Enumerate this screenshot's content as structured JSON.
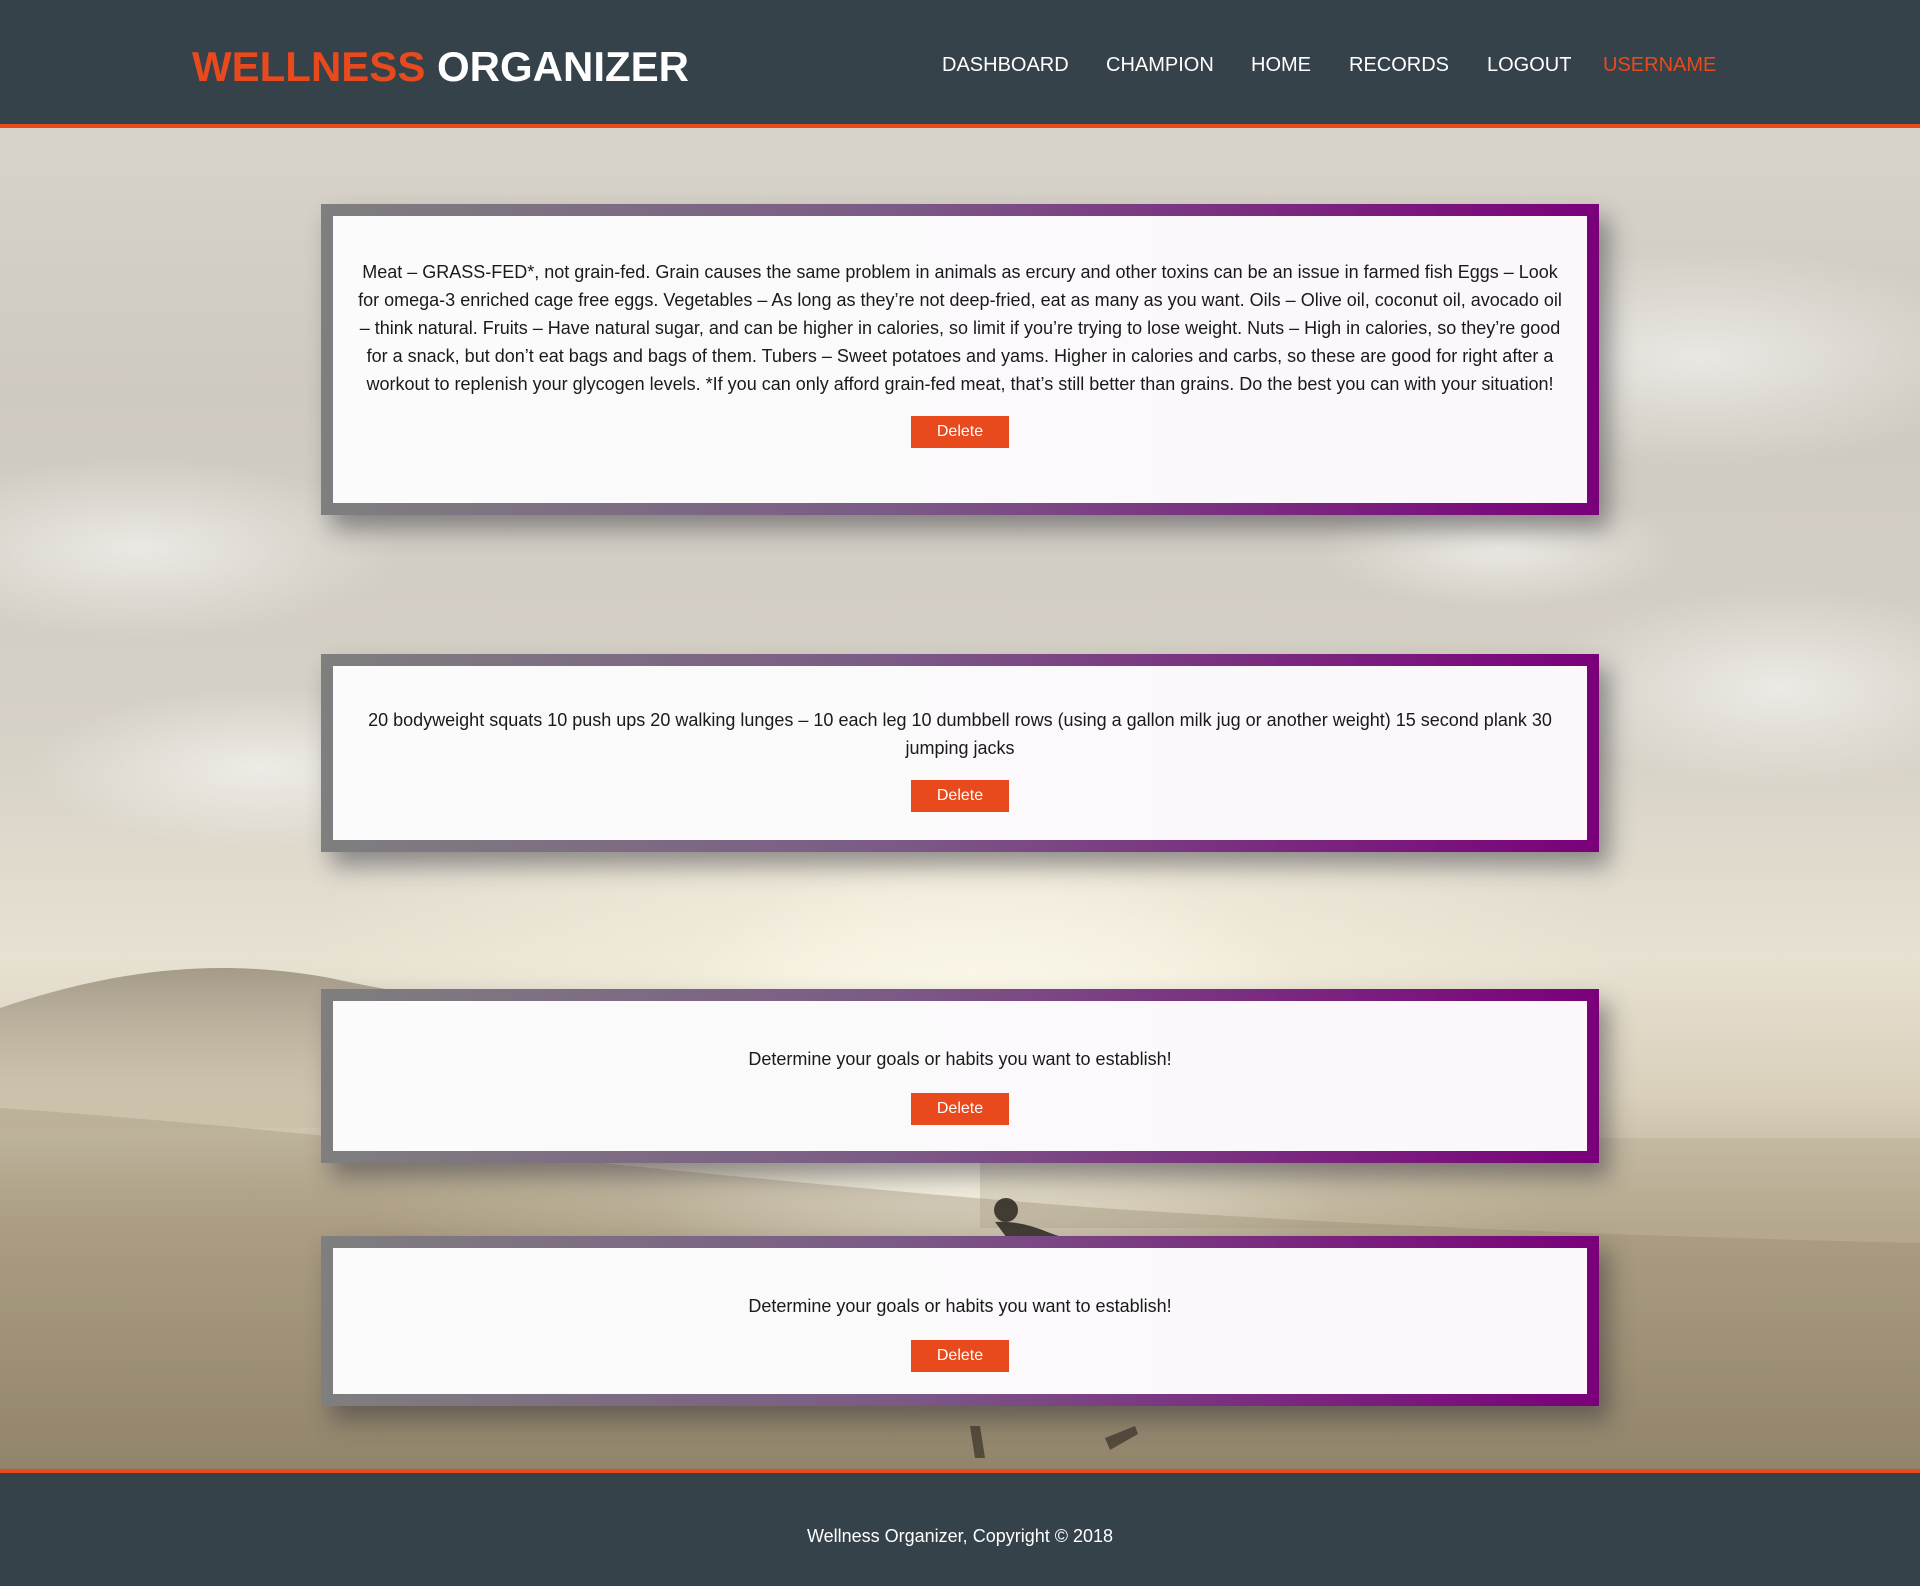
{
  "header": {
    "logo_highlight": "WELLNESS",
    "logo_rest": "ORGANIZER",
    "nav": [
      {
        "label": "DASHBOARD"
      },
      {
        "label": "CHAMPION"
      },
      {
        "label": "HOME"
      },
      {
        "label": "RECORDS"
      },
      {
        "label": "LOGOUT"
      },
      {
        "label": "USERNAME",
        "current": true
      }
    ]
  },
  "cards": [
    {
      "text": "Meat – GRASS-FED*, not grain-fed. Grain causes the same problem in animals as ercury and other toxins can be an issue in farmed fish Eggs – Look for omega-3 enriched cage free eggs. Vegetables – As long as they’re not deep-fried, eat as many as you want. Oils – Olive oil, coconut oil, avocado oil – think natural. Fruits – Have natural sugar, and can be higher in calories, so limit if you’re trying to lose weight. Nuts – High in calories, so they’re good for a snack, but don’t eat bags and bags of them. Tubers – Sweet potatoes and yams. Higher in calories and carbs, so these are good for right after a workout to replenish your glycogen levels. *If you can only afford grain-fed meat, that’s still better than grains. Do the best you can with your situation!",
      "button_label": "Delete"
    },
    {
      "text": "20 bodyweight squats 10 push ups 20 walking lunges – 10 each leg 10 dumbbell rows (using a gallon milk jug or another weight) 15 second plank 30 jumping jacks",
      "button_label": "Delete"
    },
    {
      "text": "Determine your goals or habits you want to establish!",
      "button_label": "Delete"
    },
    {
      "text": "Determine your goals or habits you want to establish!",
      "button_label": "Delete"
    }
  ],
  "footer": {
    "text": "Wellness Organizer, Copyright © 2018"
  },
  "colors": {
    "header_bg": "#35424a",
    "accent": "#e8491d",
    "card_border_start": "#7f7f7f",
    "card_border_end": "#7a007a"
  }
}
